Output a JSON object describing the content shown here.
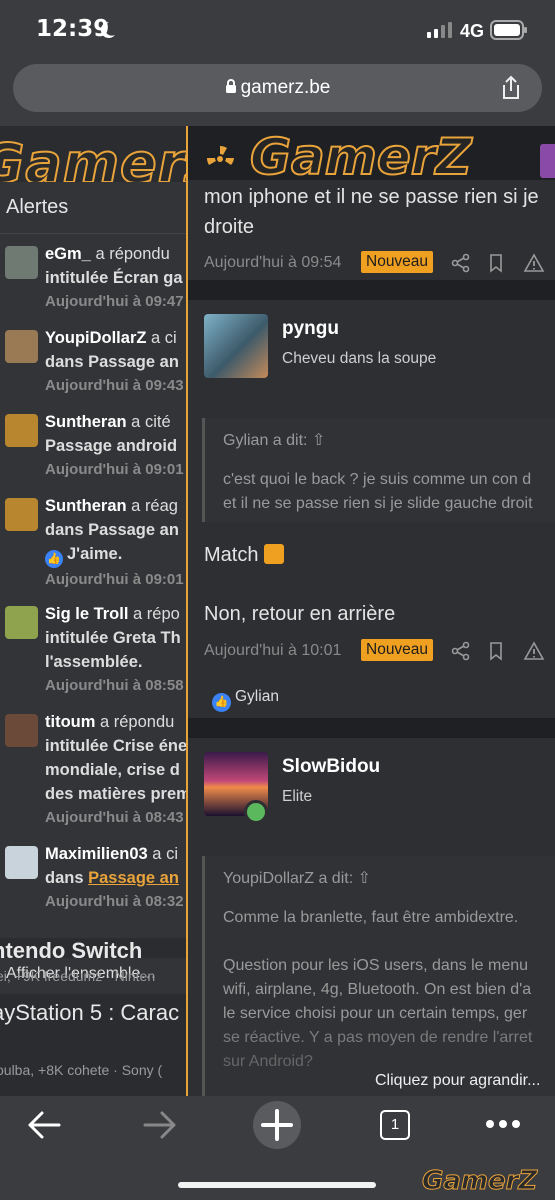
{
  "status": {
    "time": "12:39",
    "network": "4G"
  },
  "browser": {
    "url": "gamerz.be",
    "tab_count": "1"
  },
  "site": {
    "logo": "GamerZ"
  },
  "alerts": {
    "title": "Alertes",
    "items": [
      {
        "user": "eGm_",
        "line1": " a répondu",
        "line2": "intitulée Écran ga",
        "line3": "",
        "date": "Aujourd'hui à 09:47"
      },
      {
        "user": "YoupiDollarZ",
        "line1": " a ci",
        "line2": "dans Passage an",
        "line3": "",
        "date": "Aujourd'hui à 09:43"
      },
      {
        "user": "Suntheran",
        "line1": " a cité",
        "line2": "Passage android",
        "line3": "",
        "date": "Aujourd'hui à 09:01"
      },
      {
        "user": "Suntheran",
        "line1": " a réag",
        "line2": "dans Passage an",
        "line3": "J'aime.",
        "date": "Aujourd'hui à 09:01"
      },
      {
        "user": "Sig le Troll",
        "line1": " a répo",
        "line2": "intitulée Greta Th",
        "line3": "l'assemblée.",
        "date": "Aujourd'hui à 08:58"
      },
      {
        "user": "titoum",
        "line1": " a répondu",
        "line2": "intitulée Crise éne",
        "line3": "mondiale, crise d",
        "line4": "des matières prem",
        "date": "Aujourd'hui à 08:43"
      },
      {
        "user": "Maximilien03",
        "line1": " a ci",
        "line2": "dans ",
        "link": "Passage an",
        "date": "Aujourd'hui à 08:32"
      }
    ],
    "show_all": "Afficher l'ensemble…"
  },
  "threads": [
    {
      "title": "ntendo Switch",
      "meta": "ei, +9K freedumz · Ninten"
    },
    {
      "title": "ayStation 5 : Carac",
      "meta": "oulba, +8K cohete · Sony ("
    }
  ],
  "posts": {
    "top_text_1": "mon iphone et il ne se passe rien si je",
    "top_text_2": "droite",
    "top_date": "Aujourd'hui à 09:54",
    "new_badge": "Nouveau",
    "post2": {
      "user": "pyngu",
      "user_title": "Cheveu dans la soupe",
      "quote_author": "Gylian a dit:",
      "quote_line1": "c'est quoi le back ? je suis comme un con d",
      "quote_line2": "et il ne se passe rien si je slide gauche droit",
      "text1": "Match",
      "text2": "Non, retour en arrière",
      "date": "Aujourd'hui à 10:01",
      "reaction_user": "Gylian"
    },
    "post3": {
      "user": "SlowBidou",
      "user_title": "Elite",
      "quote_author": "YoupiDollarZ a dit:",
      "quote_line1": "Comme la branlette, faut être ambidextre.",
      "quote_line2": "Question pour les iOS users, dans le menu",
      "quote_line3": "wifi, airplane, 4g, Bluetooth. On est bien d'a",
      "quote_line4": "le service choisi pour un certain temps, ger",
      "quote_line5": "se réactive. Y a pas moyen de rendre l'arret",
      "quote_line6": "sur Android?",
      "expand": "Cliquez pour agrandir..."
    }
  },
  "watermark": "GamerZ"
}
